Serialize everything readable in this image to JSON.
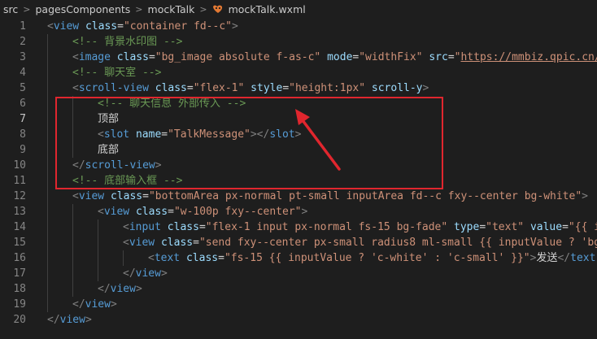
{
  "breadcrumb": {
    "items": [
      "src",
      "pagesComponents",
      "mockTalk",
      "mockTalk.wxml"
    ],
    "file_icon_color": "#e37933"
  },
  "colors": {
    "highlight": "#e0262e"
  },
  "lines": [
    {
      "n": "1",
      "indent": 0,
      "tokens": [
        [
          "punc",
          "<"
        ],
        [
          "tag",
          "view"
        ],
        [
          "text",
          " "
        ],
        [
          "attr",
          "class"
        ],
        [
          "text",
          "="
        ],
        [
          "str",
          "\"container fd--c\""
        ],
        [
          "punc",
          ">"
        ]
      ]
    },
    {
      "n": "2",
      "indent": 1,
      "tokens": [
        [
          "cmt",
          "<!-- 背景水印图 -->"
        ]
      ]
    },
    {
      "n": "3",
      "indent": 1,
      "tokens": [
        [
          "punc",
          "<"
        ],
        [
          "tag",
          "image"
        ],
        [
          "text",
          " "
        ],
        [
          "attr",
          "class"
        ],
        [
          "text",
          "="
        ],
        [
          "str",
          "\"bg_image absolute f-as-c\""
        ],
        [
          "text",
          " "
        ],
        [
          "attr",
          "mode"
        ],
        [
          "text",
          "="
        ],
        [
          "str",
          "\"widthFix\""
        ],
        [
          "text",
          " "
        ],
        [
          "attr",
          "src"
        ],
        [
          "text",
          "="
        ],
        [
          "str",
          "\""
        ],
        [
          "link",
          "https://mmbiz.qpic.cn/"
        ]
      ]
    },
    {
      "n": "4",
      "indent": 1,
      "tokens": [
        [
          "cmt",
          "<!-- 聊天室 -->"
        ]
      ]
    },
    {
      "n": "5",
      "indent": 1,
      "tokens": [
        [
          "punc",
          "<"
        ],
        [
          "tag",
          "scroll-view"
        ],
        [
          "text",
          " "
        ],
        [
          "attr",
          "class"
        ],
        [
          "text",
          "="
        ],
        [
          "str",
          "\"flex-1\""
        ],
        [
          "text",
          " "
        ],
        [
          "attr",
          "style"
        ],
        [
          "text",
          "="
        ],
        [
          "str",
          "\"height:1px\""
        ],
        [
          "text",
          " "
        ],
        [
          "attr",
          "scroll-y"
        ],
        [
          "punc",
          ">"
        ]
      ]
    },
    {
      "n": "6",
      "indent": 2,
      "tokens": [
        [
          "cmt",
          "<!-- 聊天信息 外部传入 -->"
        ]
      ]
    },
    {
      "n": "7",
      "indent": 2,
      "tokens": [
        [
          "text",
          "顶部"
        ]
      ],
      "active": true
    },
    {
      "n": "8",
      "indent": 2,
      "tokens": [
        [
          "punc",
          "<"
        ],
        [
          "tag",
          "slot"
        ],
        [
          "text",
          " "
        ],
        [
          "attr",
          "name"
        ],
        [
          "text",
          "="
        ],
        [
          "str",
          "\"TalkMessage\""
        ],
        [
          "punc",
          "></"
        ],
        [
          "tag",
          "slot"
        ],
        [
          "punc",
          ">"
        ]
      ]
    },
    {
      "n": "9",
      "indent": 2,
      "tokens": [
        [
          "text",
          "底部"
        ]
      ]
    },
    {
      "n": "10",
      "indent": 1,
      "tokens": [
        [
          "punc",
          "</"
        ],
        [
          "tag",
          "scroll-view"
        ],
        [
          "punc",
          ">"
        ]
      ]
    },
    {
      "n": "11",
      "indent": 1,
      "tokens": [
        [
          "cmt",
          "<!-- 底部输入框 -->"
        ]
      ]
    },
    {
      "n": "12",
      "indent": 1,
      "tokens": [
        [
          "punc",
          "<"
        ],
        [
          "tag",
          "view"
        ],
        [
          "text",
          " "
        ],
        [
          "attr",
          "class"
        ],
        [
          "text",
          "="
        ],
        [
          "str",
          "\"bottomArea px-normal pt-small inputArea fd--c fxy--center bg-white\""
        ],
        [
          "punc",
          ">"
        ]
      ]
    },
    {
      "n": "13",
      "indent": 2,
      "tokens": [
        [
          "punc",
          "<"
        ],
        [
          "tag",
          "view"
        ],
        [
          "text",
          " "
        ],
        [
          "attr",
          "class"
        ],
        [
          "text",
          "="
        ],
        [
          "str",
          "\"w-100p fxy--center\""
        ],
        [
          "punc",
          ">"
        ]
      ]
    },
    {
      "n": "14",
      "indent": 3,
      "tokens": [
        [
          "punc",
          "<"
        ],
        [
          "tag",
          "input"
        ],
        [
          "text",
          " "
        ],
        [
          "attr",
          "class"
        ],
        [
          "text",
          "="
        ],
        [
          "str",
          "\"flex-1 input px-normal fs-15 bg-fade\""
        ],
        [
          "text",
          " "
        ],
        [
          "attr",
          "type"
        ],
        [
          "text",
          "="
        ],
        [
          "str",
          "\"text\""
        ],
        [
          "text",
          " "
        ],
        [
          "attr",
          "value"
        ],
        [
          "text",
          "="
        ],
        [
          "str",
          "\"{{ i"
        ]
      ]
    },
    {
      "n": "15",
      "indent": 3,
      "tokens": [
        [
          "punc",
          "<"
        ],
        [
          "tag",
          "view"
        ],
        [
          "text",
          " "
        ],
        [
          "attr",
          "class"
        ],
        [
          "text",
          "="
        ],
        [
          "str",
          "\"send fxy--center px-small radius8 ml-small {{ inputValue ? 'bg"
        ]
      ]
    },
    {
      "n": "16",
      "indent": 4,
      "tokens": [
        [
          "punc",
          "<"
        ],
        [
          "tag",
          "text"
        ],
        [
          "text",
          " "
        ],
        [
          "attr",
          "class"
        ],
        [
          "text",
          "="
        ],
        [
          "str",
          "\"fs-15 {{ inputValue ? 'c-white' : 'c-small' }}\""
        ],
        [
          "punc",
          ">"
        ],
        [
          "text",
          "发送"
        ],
        [
          "punc",
          "</"
        ],
        [
          "tag",
          "text"
        ]
      ]
    },
    {
      "n": "17",
      "indent": 3,
      "tokens": [
        [
          "punc",
          "</"
        ],
        [
          "tag",
          "view"
        ],
        [
          "punc",
          ">"
        ]
      ]
    },
    {
      "n": "18",
      "indent": 2,
      "tokens": [
        [
          "punc",
          "</"
        ],
        [
          "tag",
          "view"
        ],
        [
          "punc",
          ">"
        ]
      ]
    },
    {
      "n": "19",
      "indent": 1,
      "tokens": [
        [
          "punc",
          "</"
        ],
        [
          "tag",
          "view"
        ],
        [
          "punc",
          ">"
        ]
      ]
    },
    {
      "n": "20",
      "indent": 0,
      "tokens": [
        [
          "punc",
          "</"
        ],
        [
          "tag",
          "view"
        ],
        [
          "punc",
          ">"
        ]
      ]
    }
  ]
}
